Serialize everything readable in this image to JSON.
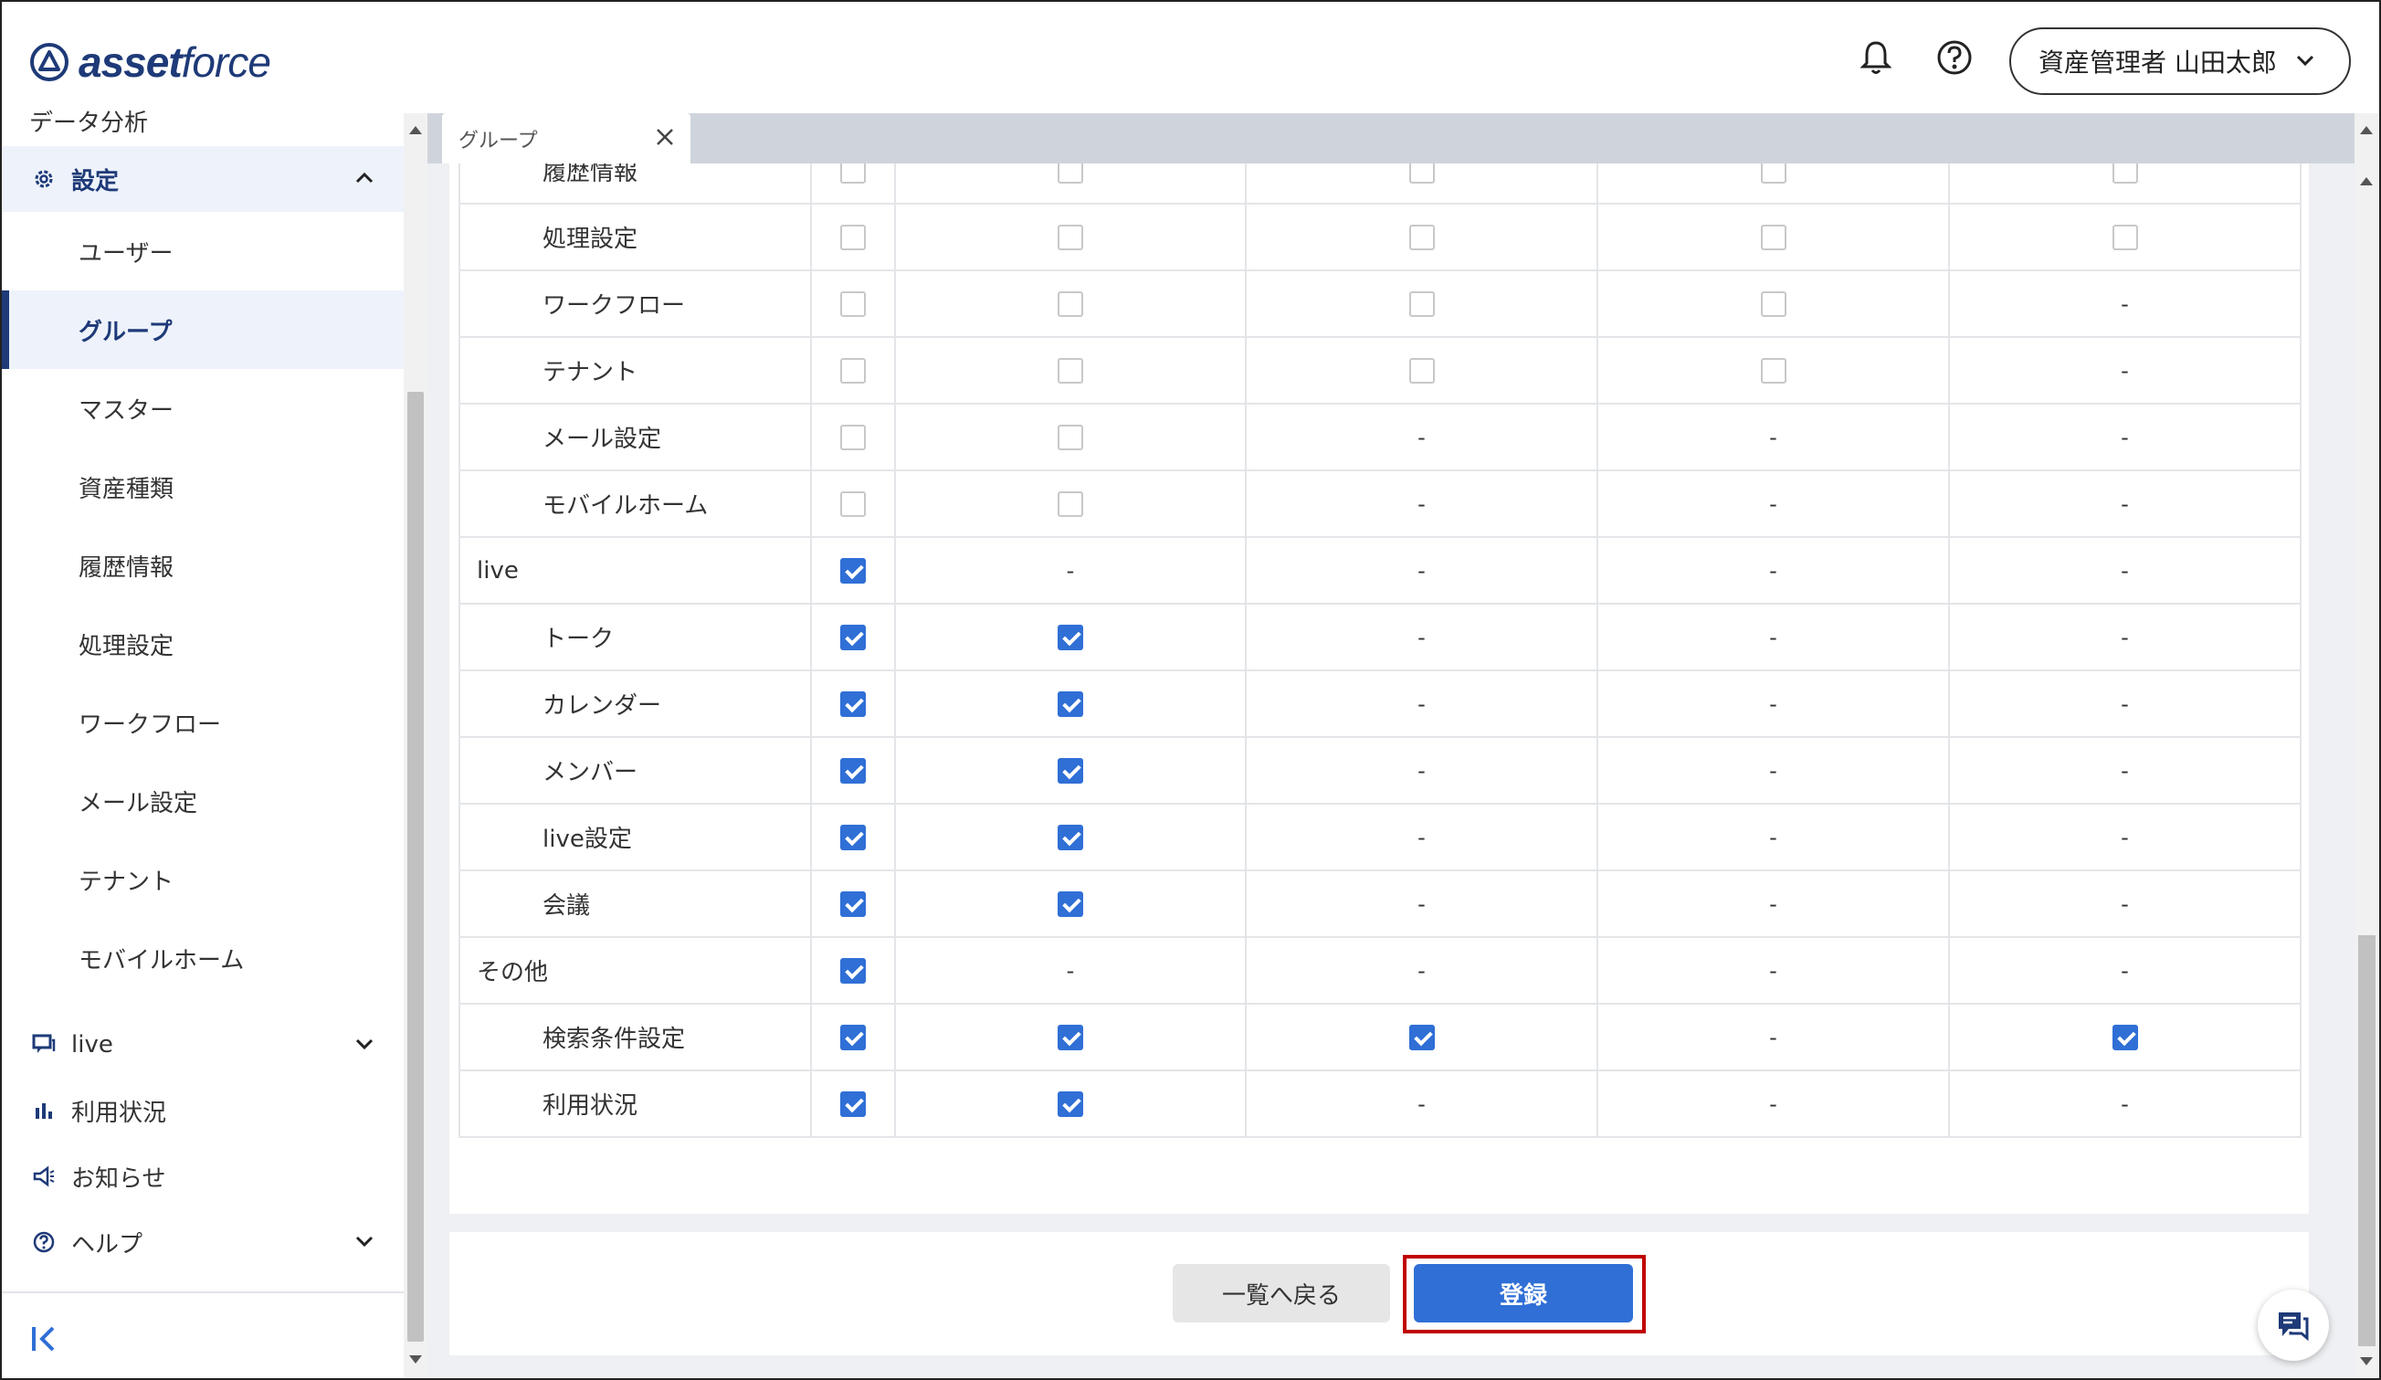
{
  "header": {
    "logo_bold": "asset",
    "logo_light": "force",
    "user_label": "資産管理者 山田太郎"
  },
  "sidebar": {
    "cut_item": "データ分析",
    "settings_label": "設定",
    "sub_items": [
      "ユーザー",
      "グループ",
      "マスター",
      "資産種類",
      "履歴情報",
      "処理設定",
      "ワークフロー",
      "メール設定",
      "テナント",
      "モバイルホーム"
    ],
    "selected": "グループ",
    "live_label": "live",
    "usage_label": "利用状況",
    "notice_label": "お知らせ",
    "help_label": "ヘルプ"
  },
  "tab": {
    "label": "グループ"
  },
  "table": {
    "rows": [
      {
        "label": "履歴情報",
        "child": true,
        "cells": [
          "off",
          "off",
          "off",
          "off",
          "off"
        ]
      },
      {
        "label": "処理設定",
        "child": true,
        "cells": [
          "off",
          "off",
          "off",
          "off",
          "off"
        ]
      },
      {
        "label": "ワークフロー",
        "child": true,
        "cells": [
          "off",
          "off",
          "off",
          "off",
          "-"
        ]
      },
      {
        "label": "テナント",
        "child": true,
        "cells": [
          "off",
          "off",
          "off",
          "off",
          "-"
        ]
      },
      {
        "label": "メール設定",
        "child": true,
        "cells": [
          "off",
          "off",
          "-",
          "-",
          "-"
        ]
      },
      {
        "label": "モバイルホーム",
        "child": true,
        "cells": [
          "off",
          "off",
          "-",
          "-",
          "-"
        ]
      },
      {
        "label": "live",
        "child": false,
        "cells": [
          "on",
          "-",
          "-",
          "-",
          "-"
        ]
      },
      {
        "label": "トーク",
        "child": true,
        "cells": [
          "on",
          "on",
          "-",
          "-",
          "-"
        ]
      },
      {
        "label": "カレンダー",
        "child": true,
        "cells": [
          "on",
          "on",
          "-",
          "-",
          "-"
        ]
      },
      {
        "label": "メンバー",
        "child": true,
        "cells": [
          "on",
          "on",
          "-",
          "-",
          "-"
        ]
      },
      {
        "label": "live設定",
        "child": true,
        "cells": [
          "on",
          "on",
          "-",
          "-",
          "-"
        ]
      },
      {
        "label": "会議",
        "child": true,
        "cells": [
          "on",
          "on",
          "-",
          "-",
          "-"
        ]
      },
      {
        "label": "その他",
        "child": false,
        "cells": [
          "on",
          "-",
          "-",
          "-",
          "-"
        ]
      },
      {
        "label": "検索条件設定",
        "child": true,
        "cells": [
          "on",
          "on",
          "on",
          "-",
          "on"
        ]
      },
      {
        "label": "利用状況",
        "child": true,
        "cells": [
          "on",
          "on",
          "-",
          "-",
          "-"
        ]
      }
    ]
  },
  "footer": {
    "back_label": "一覧へ戻る",
    "register_label": "登録"
  },
  "colors": {
    "primary": "#2f6fd6",
    "brand": "#1e3a78",
    "highlight": "#c00000"
  }
}
